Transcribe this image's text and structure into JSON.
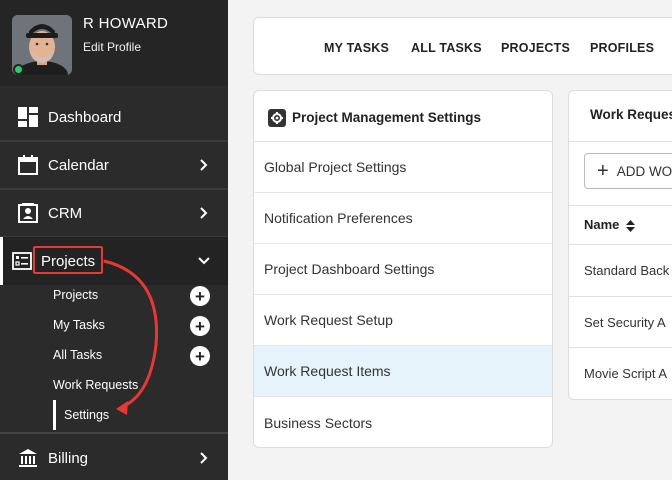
{
  "profile": {
    "name": "R HOWARD",
    "edit_label": "Edit Profile"
  },
  "sidebar": {
    "items": [
      {
        "label": "Dashboard",
        "icon": "dashboard-icon"
      },
      {
        "label": "Calendar",
        "icon": "calendar-icon"
      },
      {
        "label": "CRM",
        "icon": "contact-card-icon"
      },
      {
        "label": "Projects",
        "icon": "checklist-icon"
      },
      {
        "label": "Billing",
        "icon": "bank-icon"
      }
    ],
    "sub_items": [
      {
        "label": "Projects"
      },
      {
        "label": "My Tasks"
      },
      {
        "label": "All Tasks"
      },
      {
        "label": "Work Requests"
      },
      {
        "label": "Settings"
      }
    ]
  },
  "topnav": {
    "tabs": [
      "MY TASKS",
      "ALL TASKS",
      "PROJECTS",
      "PROFILES"
    ]
  },
  "settings_panel": {
    "title": "Project Management Settings",
    "rows": [
      "Global Project Settings",
      "Notification Preferences",
      "Project Dashboard Settings",
      "Work Request Setup",
      "Work Request Items",
      "Business Sectors"
    ],
    "selected_index": 4
  },
  "work_requests_panel": {
    "title": "Work Reques",
    "add_label": "ADD WO",
    "column_name": "Name",
    "rows": [
      "Standard Back",
      "Set Security A",
      "Movie Script A"
    ]
  },
  "colors": {
    "accent_red": "#e53935",
    "status_green": "#2ecc71",
    "selected_row": "#e6f3fb"
  }
}
